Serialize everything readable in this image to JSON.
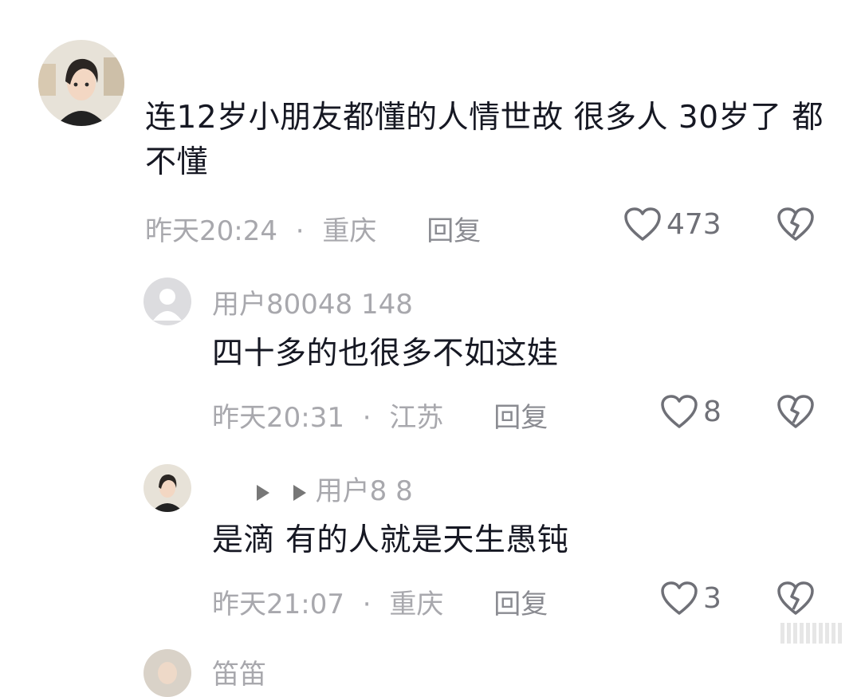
{
  "comments": [
    {
      "text": "连12岁小朋友都懂的人情世故 很多人 30岁了 都不懂",
      "time": "昨天20:24",
      "location": "重庆",
      "reply_label": "回复",
      "likes": "473"
    },
    {
      "username": "用户80048 148",
      "text": "四十多的也很多不如这娃",
      "time": "昨天20:31",
      "location": "江苏",
      "reply_label": "回复",
      "likes": "8"
    },
    {
      "username": "用户8 8",
      "text": "是滴 有的人就是天生愚钝",
      "time": "昨天21:07",
      "location": "重庆",
      "reply_label": "回复",
      "likes": "3"
    },
    {
      "username": "笛笛"
    }
  ],
  "separator": "·",
  "icons": {
    "like": "heart-outline-icon",
    "dislike": "broken-heart-icon",
    "default_avatar": "default-user-icon"
  },
  "colors": {
    "text_primary": "#161823",
    "text_secondary": "#a8a8ad",
    "icon": "#6f7077"
  }
}
